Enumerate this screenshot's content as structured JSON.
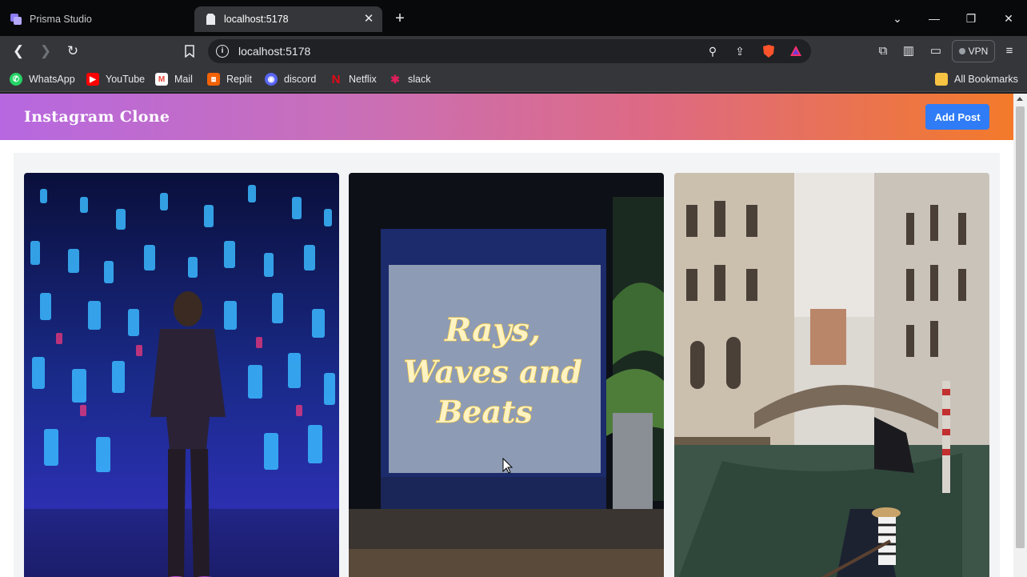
{
  "browser": {
    "tabs": [
      {
        "title": "Prisma Studio",
        "active": false
      },
      {
        "title": "localhost:5178",
        "active": true
      }
    ],
    "url": "localhost:5178",
    "vpn_label": "VPN",
    "bookmarks": [
      {
        "label": "WhatsApp",
        "icon": "whatsapp-icon",
        "color": "#25d366"
      },
      {
        "label": "YouTube",
        "icon": "youtube-icon",
        "color": "#ff0000"
      },
      {
        "label": "Mail",
        "icon": "gmail-icon",
        "color": "#ea4335"
      },
      {
        "label": "Replit",
        "icon": "replit-icon",
        "color": "#f26207"
      },
      {
        "label": "discord",
        "icon": "discord-icon",
        "color": "#5865f2"
      },
      {
        "label": "Netflix",
        "icon": "netflix-icon",
        "color": "#e50914"
      },
      {
        "label": "slack",
        "icon": "slack-icon",
        "color": "#e01e5a"
      }
    ],
    "all_bookmarks_label": "All Bookmarks"
  },
  "app": {
    "title": "Instagram Clone",
    "add_post_label": "Add Post",
    "accent": "#2f7cf6",
    "header_gradient": [
      "#b768e0",
      "#f37a2a"
    ]
  },
  "posts": [
    {
      "alt": "Man standing in a room of glowing blue lanterns"
    },
    {
      "alt": "Neon sign on wall",
      "sign_lines": [
        "Rays,",
        "Waves and",
        "Beats"
      ]
    },
    {
      "alt": "Venice canal with bridge and gondolier"
    }
  ]
}
